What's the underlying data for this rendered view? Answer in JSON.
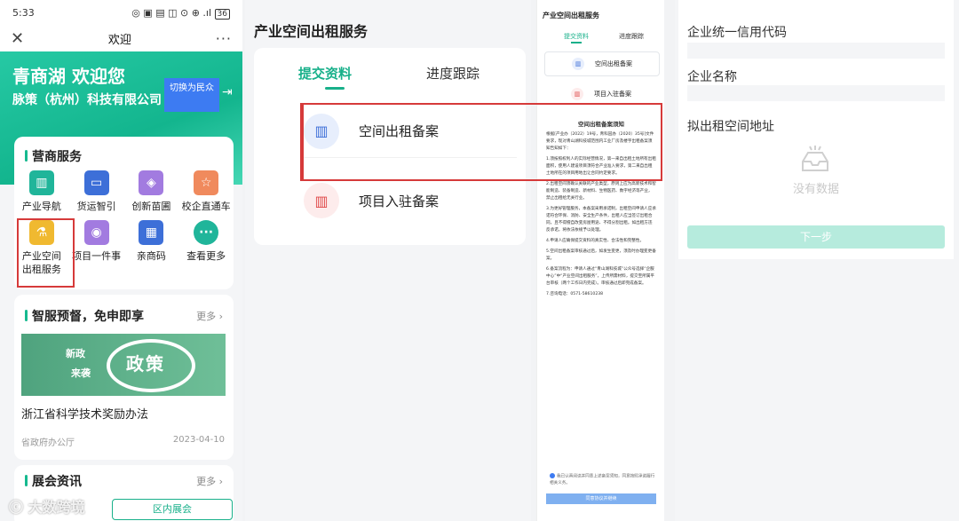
{
  "statusbar": {
    "time": "5:33",
    "icons": "◎ ▣ ▤ ◫ ⊙ ⊕ .ıl",
    "battery": "36"
  },
  "navbar": {
    "close_icon": "close-icon",
    "title": "欢迎",
    "more": "···"
  },
  "hero": {
    "welcome": "青商湖 欢迎您",
    "company": "脉策（杭州）科技有限公司",
    "switch_label": "切换为民众",
    "logout_icon": "logout-icon"
  },
  "services": {
    "title": "营商服务",
    "items": [
      {
        "label": "产业导航",
        "icon": "building-icon",
        "color": "#20b59a"
      },
      {
        "label": "货运智引",
        "icon": "monitor-icon",
        "color": "#3d6fd8"
      },
      {
        "label": "创新苗圃",
        "icon": "tag-icon",
        "color": "#a27be0"
      },
      {
        "label": "校企直通车",
        "icon": "badge-icon",
        "color": "#f08a5d"
      },
      {
        "label": "产业空间出租服务",
        "icon": "flask-icon",
        "color": "#f0b930"
      },
      {
        "label": "项目一件事",
        "icon": "bulb-icon",
        "color": "#a27be0"
      },
      {
        "label": "亲商码",
        "icon": "qr-icon",
        "color": "#3d6fd8"
      },
      {
        "label": "查看更多",
        "icon": "more-icon",
        "color": "#20b59a"
      }
    ]
  },
  "smart": {
    "title": "智服预督，免申即享",
    "more": "更多 ›",
    "banner_big": "政策",
    "banner_small1": "新政",
    "banner_small2": "来袭",
    "article_title": "浙江省科学技术奖励办法",
    "source": "省政府办公厅",
    "date": "2023-04-10"
  },
  "expo": {
    "title": "展会资讯",
    "more": "更多 ›",
    "tab": "区内展会",
    "watermark": "大数跨境"
  },
  "panel2": {
    "title": "产业空间出租服务",
    "tab_submit": "提交资料",
    "tab_track": "进度跟踪",
    "item1": "空间出租备案",
    "item2": "项目入驻备案"
  },
  "panel3": {
    "title": "产业空间出租服务",
    "tab_submit": "提交资料",
    "tab_track": "进度跟踪",
    "item1": "空间出租备案",
    "item2": "项目入驻备案",
    "notice_title": "空间出租备案须知",
    "notice_paragraphs": [
      "根据[产业办（2022）19号，青科园办（2020）35号]文件要求，现对青山湖科技城范围内工业厂房及楼宇出租备案须知告知如下：",
      "1.须按照权利人的实际经营情况，第一来自出租土地所有出租面积，使用人建设项目须符合产业准入要求，第二来自出租土地所在的项目用地出让合同约定要求。",
      "2.出租空间须确认关联的产业类型，原则上应为高新技术和智能制造、装备制造、新材料、生物医药、数字经济等产业，禁止出租给无关行业。",
      "3.为更好管理服务，本备案采用承诺制，出租空间申请人应承诺符合环保、消防、安全生产条件，出租人应当签订出租合同，且不得擅自改变房屋用途、不得分割出租。如出租方违反承诺，将依法依规予以处理。",
      "4.申请人应确保提交资料的真实性、合法性和完整性。",
      "5.空间出租备案审核通过后，如发生变更，须及时办理变更备案。",
      "6.备案流程为：申请人通过“青山湖科技城”公众号选择“企服中心”中“产业空间出租服务”，上传所需材料，提交至所属平台审核（两个工作日内完成）。审核通过后即完成备案。",
      "7.咨询电话：0571-58610238"
    ],
    "agree_text": "我已认真阅读并同意上述备案须知，同意按照承诺履行相关义务。",
    "button": "同意协议并继续"
  },
  "panel4": {
    "label_code": "企业统一信用代码",
    "label_name": "企业名称",
    "label_address": "拟出租空间地址",
    "empty_text": "没有数据",
    "next_button": "下一步"
  }
}
